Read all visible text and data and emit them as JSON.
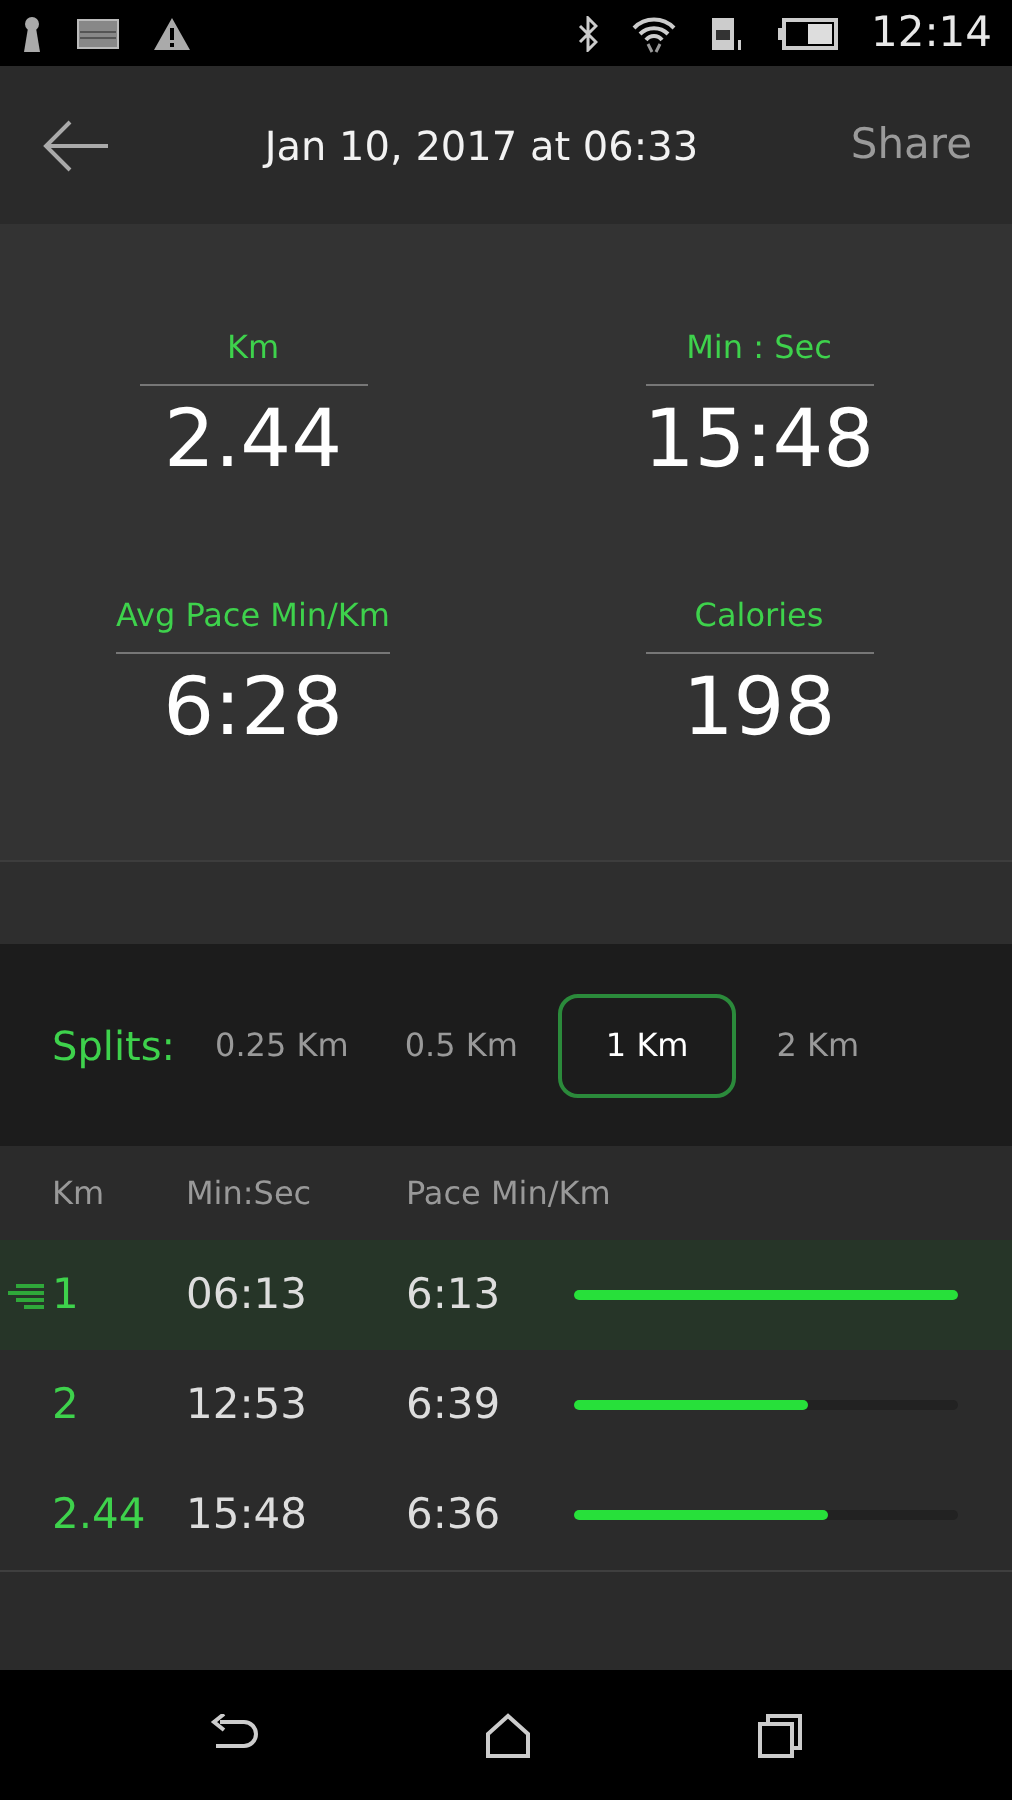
{
  "status_bar": {
    "time": "12:14"
  },
  "header": {
    "title": "Jan 10, 2017 at 06:33",
    "action": "Share"
  },
  "stats": [
    {
      "label": "Km",
      "value": "2.44"
    },
    {
      "label": "Min : Sec",
      "value": "15:48"
    },
    {
      "label": "Avg Pace Min/Km",
      "value": "6:28"
    },
    {
      "label": "Calories",
      "value": "198"
    }
  ],
  "splits": {
    "label": "Splits:",
    "options": [
      {
        "label": "0.25 Km",
        "selected": false
      },
      {
        "label": "0.5 Km",
        "selected": false
      },
      {
        "label": "1 Km",
        "selected": true
      },
      {
        "label": "2 Km",
        "selected": false
      }
    ]
  },
  "table": {
    "columns": [
      "Km",
      "Min:Sec",
      "Pace Min/Km"
    ],
    "rows": [
      {
        "km": "1",
        "time": "06:13",
        "pace": "6:13",
        "level": 1.0,
        "highlighted": true
      },
      {
        "km": "2",
        "time": "12:53",
        "pace": "6:39",
        "level": 0.61,
        "highlighted": false
      },
      {
        "km": "2.44",
        "time": "15:48",
        "pace": "6:36",
        "level": 0.66,
        "highlighted": false
      }
    ]
  }
}
